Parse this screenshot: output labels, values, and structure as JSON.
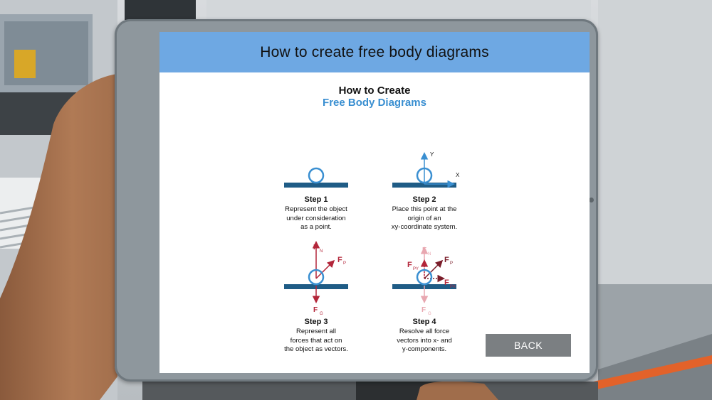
{
  "header": {
    "title": "How to create free body diagrams"
  },
  "infographic": {
    "title_line1": "How to Create",
    "title_line2": "Free Body Diagrams",
    "steps": [
      {
        "title": "Step 1",
        "lines": [
          "Represent the object",
          "under consideration",
          "as a point."
        ]
      },
      {
        "title": "Step 2",
        "lines": [
          "Place this point at the",
          "origin of an",
          "xy-coordinate system."
        ]
      },
      {
        "title": "Step 3",
        "lines": [
          "Represent all",
          "forces that act on",
          "the object as vectors."
        ]
      },
      {
        "title": "Step 4",
        "lines": [
          "Resolve all force",
          "vectors into x- and",
          "y-components."
        ]
      }
    ],
    "axis_labels": {
      "y": "Y",
      "x": "X"
    },
    "force_labels": {
      "normal": "F",
      "normal_sub": "N",
      "pull": "F",
      "pull_sub": "P",
      "gravity": "F",
      "gravity_sub": "G",
      "pull_y": "F",
      "pull_y_sub": "PY",
      "pull_x": "F",
      "pull_x_sub": "PX"
    },
    "colors": {
      "accent_blue": "#3a8fd1",
      "force_red": "#b3263a",
      "ground": "#1f5c86"
    }
  },
  "buttons": {
    "back_label": "BACK"
  }
}
